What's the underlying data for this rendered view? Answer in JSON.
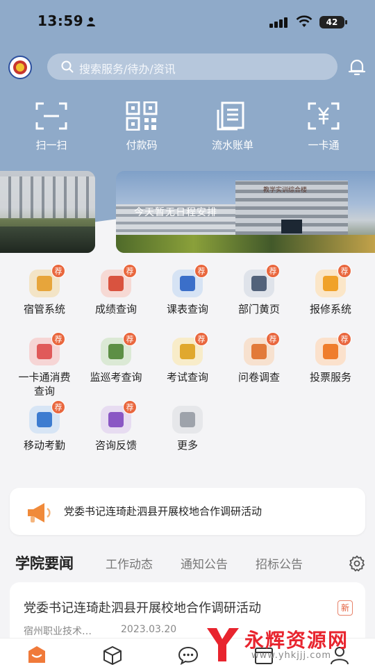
{
  "status_bar": {
    "time": "13:59",
    "battery": "42"
  },
  "search": {
    "placeholder": "搜索服务/待办/资讯"
  },
  "quick_actions": [
    {
      "label": "扫一扫",
      "icon": "scan-icon"
    },
    {
      "label": "付款码",
      "icon": "qr-code-icon"
    },
    {
      "label": "流水账单",
      "icon": "ledger-icon"
    },
    {
      "label": "一卡通",
      "icon": "card-yuan-icon"
    }
  ],
  "banner": {
    "text": "今天暂无日程安排",
    "building_sign": "教学实训综合楼"
  },
  "services": [
    {
      "label": "宿管系统",
      "badge": "荐",
      "color": "#f3e4c6",
      "glyph": "#e7a53b"
    },
    {
      "label": "成绩查询",
      "badge": "荐",
      "color": "#f6d9d4",
      "glyph": "#d9533f"
    },
    {
      "label": "课表查询",
      "badge": "荐",
      "color": "#d6e3f4",
      "glyph": "#3b6fc9"
    },
    {
      "label": "部门黄页",
      "badge": "荐",
      "color": "#dfe3ea",
      "glyph": "#52627a"
    },
    {
      "label": "报修系统",
      "badge": "荐",
      "color": "#fbe6c8",
      "glyph": "#f0a22a"
    },
    {
      "label": "一卡通消费查询",
      "badge": "荐",
      "color": "#f6d5d5",
      "glyph": "#e05a5a"
    },
    {
      "label": "监巡考查询",
      "badge": "荐",
      "color": "#dbe9d5",
      "glyph": "#5d8f45"
    },
    {
      "label": "考试查询",
      "badge": "荐",
      "color": "#f8ecc9",
      "glyph": "#e0a82e"
    },
    {
      "label": "问卷调查",
      "badge": "荐",
      "color": "#f7e1cf",
      "glyph": "#e27a3a"
    },
    {
      "label": "投票服务",
      "badge": "荐",
      "color": "#fbe1cc",
      "glyph": "#ef7d2c"
    },
    {
      "label": "移动考勤",
      "badge": "荐",
      "color": "#d7e5f5",
      "glyph": "#3d7cd0"
    },
    {
      "label": "咨询反馈",
      "badge": "荐",
      "color": "#e7dcf1",
      "glyph": "#8a57c4"
    },
    {
      "label": "更多",
      "badge": "",
      "color": "#e6e7ea",
      "glyph": "#9ea3ab"
    }
  ],
  "notice": {
    "text": "党委书记连琦赴泗县开展校地合作调研活动"
  },
  "news_tabs": [
    {
      "label": "学院要闻",
      "active": true
    },
    {
      "label": "工作动态",
      "active": false
    },
    {
      "label": "通知公告",
      "active": false
    },
    {
      "label": "招标公告",
      "active": false
    }
  ],
  "news": {
    "title": "党委书记连琦赴泗县开展校地合作调研活动",
    "badge": "新",
    "source": "宿州职业技术…",
    "date": "2023.03.20"
  },
  "bottom_nav": [
    "home-icon",
    "cube-icon",
    "chat-icon",
    "calendar-icon",
    "profile-icon"
  ],
  "watermark": {
    "title": "永辉资源网",
    "url": "www.yhkjjj.com"
  }
}
